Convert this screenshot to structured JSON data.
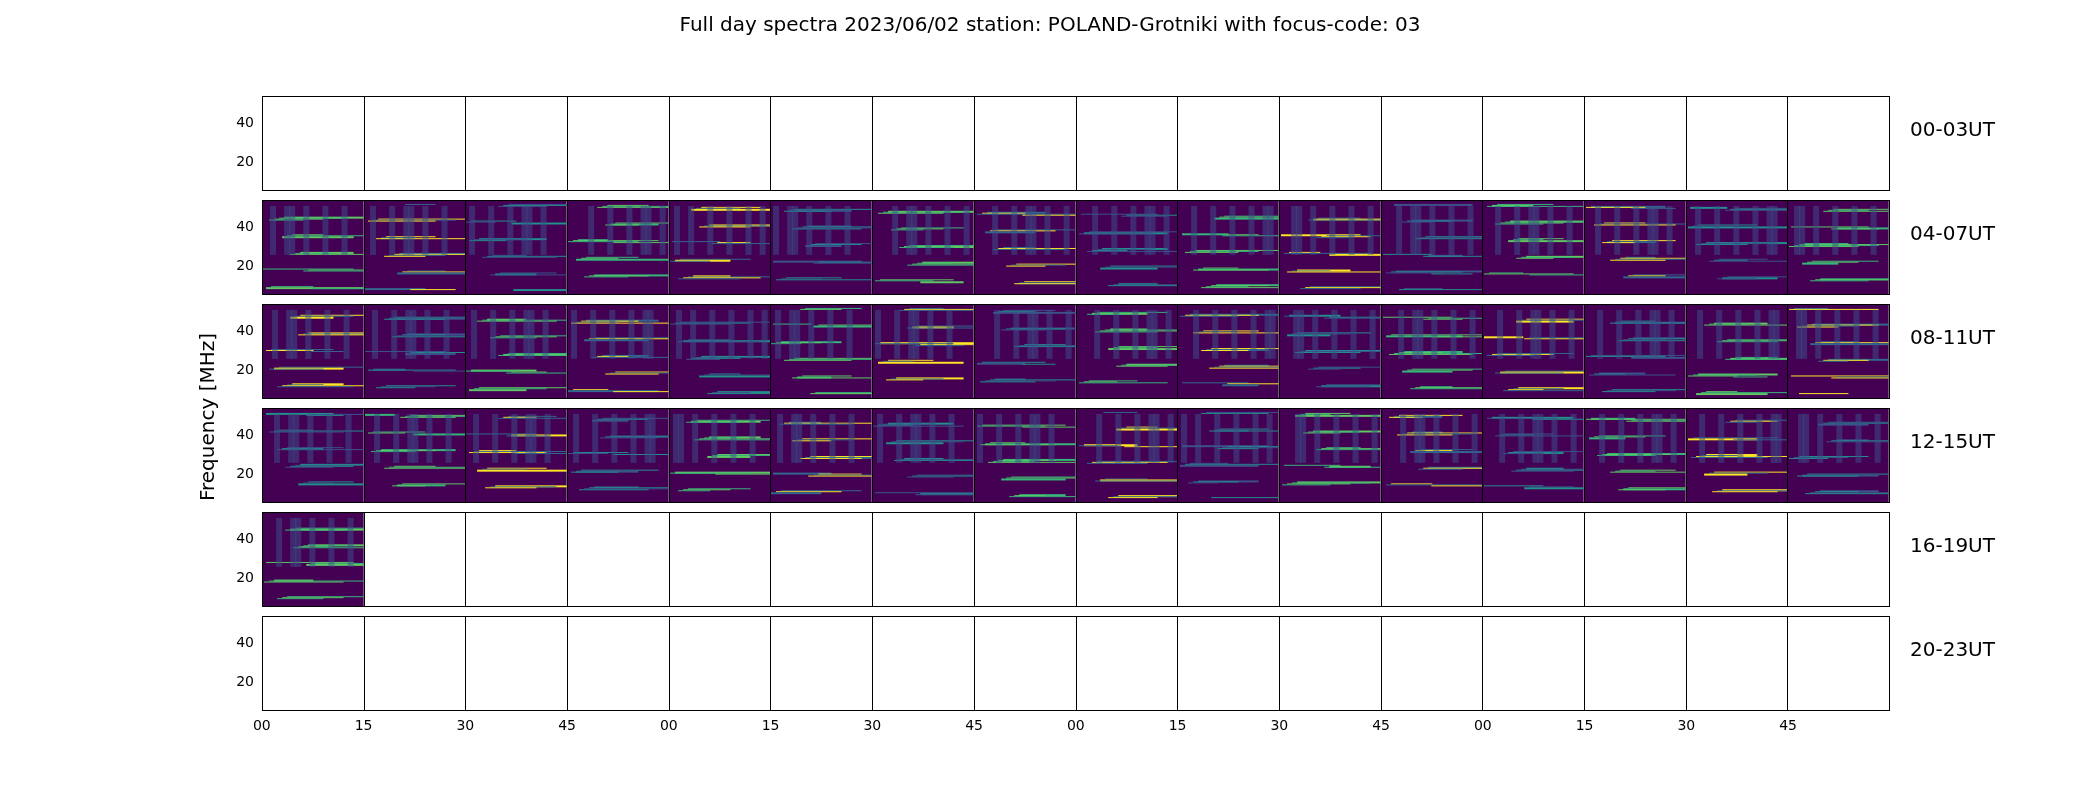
{
  "title": "Full day spectra 2023/06/02 station: POLAND-Grotniki with focus-code: 03",
  "ylabel": "Frequency [MHz]",
  "rows": [
    {
      "label": "00-03UT",
      "y_ticks": [
        "40",
        "20"
      ],
      "panels": [
        {
          "has_data": false
        },
        {
          "has_data": false
        },
        {
          "has_data": false
        },
        {
          "has_data": false
        },
        {
          "has_data": false
        },
        {
          "has_data": false
        },
        {
          "has_data": false
        },
        {
          "has_data": false
        },
        {
          "has_data": false
        },
        {
          "has_data": false
        },
        {
          "has_data": false
        },
        {
          "has_data": false
        },
        {
          "has_data": false
        },
        {
          "has_data": false
        },
        {
          "has_data": false
        },
        {
          "has_data": false
        }
      ]
    },
    {
      "label": "04-07UT",
      "y_ticks": [
        "40",
        "20"
      ],
      "panels": [
        {
          "has_data": true
        },
        {
          "has_data": true
        },
        {
          "has_data": true
        },
        {
          "has_data": true
        },
        {
          "has_data": true
        },
        {
          "has_data": true
        },
        {
          "has_data": true
        },
        {
          "has_data": true
        },
        {
          "has_data": true
        },
        {
          "has_data": true
        },
        {
          "has_data": true
        },
        {
          "has_data": true
        },
        {
          "has_data": true
        },
        {
          "has_data": true
        },
        {
          "has_data": true
        },
        {
          "has_data": true
        }
      ]
    },
    {
      "label": "08-11UT",
      "y_ticks": [
        "40",
        "20"
      ],
      "panels": [
        {
          "has_data": true
        },
        {
          "has_data": true
        },
        {
          "has_data": true
        },
        {
          "has_data": true
        },
        {
          "has_data": true
        },
        {
          "has_data": true
        },
        {
          "has_data": true
        },
        {
          "has_data": true
        },
        {
          "has_data": true
        },
        {
          "has_data": true
        },
        {
          "has_data": true
        },
        {
          "has_data": true
        },
        {
          "has_data": true
        },
        {
          "has_data": true
        },
        {
          "has_data": true
        },
        {
          "has_data": true
        }
      ]
    },
    {
      "label": "12-15UT",
      "y_ticks": [
        "40",
        "20"
      ],
      "panels": [
        {
          "has_data": true
        },
        {
          "has_data": true
        },
        {
          "has_data": true
        },
        {
          "has_data": true
        },
        {
          "has_data": true
        },
        {
          "has_data": true
        },
        {
          "has_data": true
        },
        {
          "has_data": true
        },
        {
          "has_data": true
        },
        {
          "has_data": true
        },
        {
          "has_data": true
        },
        {
          "has_data": true
        },
        {
          "has_data": true
        },
        {
          "has_data": true
        },
        {
          "has_data": true
        },
        {
          "has_data": true
        }
      ]
    },
    {
      "label": "16-19UT",
      "y_ticks": [
        "40",
        "20"
      ],
      "panels": [
        {
          "has_data": true
        },
        {
          "has_data": false
        },
        {
          "has_data": false
        },
        {
          "has_data": false
        },
        {
          "has_data": false
        },
        {
          "has_data": false
        },
        {
          "has_data": false
        },
        {
          "has_data": false
        },
        {
          "has_data": false
        },
        {
          "has_data": false
        },
        {
          "has_data": false
        },
        {
          "has_data": false
        },
        {
          "has_data": false
        },
        {
          "has_data": false
        },
        {
          "has_data": false
        },
        {
          "has_data": false
        }
      ]
    },
    {
      "label": "20-23UT",
      "y_ticks": [
        "40",
        "20"
      ],
      "panels": [
        {
          "has_data": false
        },
        {
          "has_data": false
        },
        {
          "has_data": false
        },
        {
          "has_data": false
        },
        {
          "has_data": false
        },
        {
          "has_data": false
        },
        {
          "has_data": false
        },
        {
          "has_data": false
        },
        {
          "has_data": false
        },
        {
          "has_data": false
        },
        {
          "has_data": false
        },
        {
          "has_data": false
        },
        {
          "has_data": false
        },
        {
          "has_data": false
        },
        {
          "has_data": false
        },
        {
          "has_data": false
        }
      ]
    }
  ],
  "x_ticks": [
    "00",
    "15",
    "30",
    "45",
    "00",
    "15",
    "30",
    "45",
    "00",
    "15",
    "30",
    "45",
    "00",
    "15",
    "30",
    "45"
  ]
}
